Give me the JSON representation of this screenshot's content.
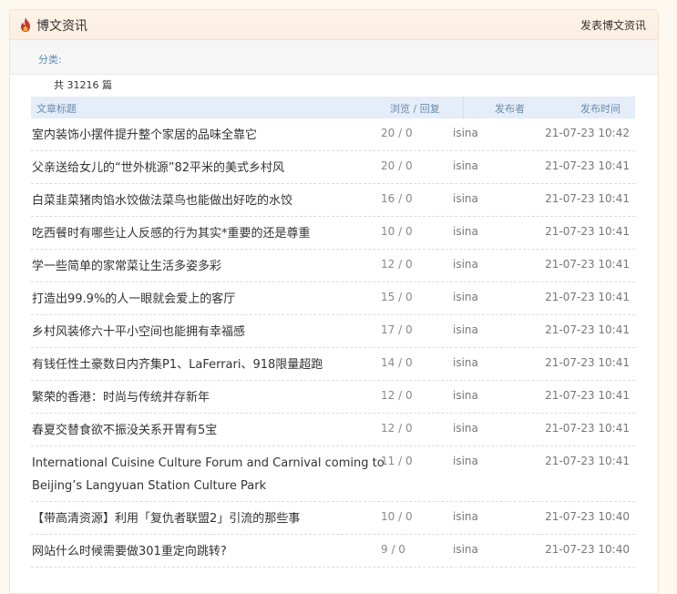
{
  "header": {
    "title": "博文资讯",
    "post_link": "发表博文资讯",
    "icon": "flame-icon",
    "accent_color": "#c0392b"
  },
  "filter": {
    "label": "分类:"
  },
  "summary": {
    "total": "共 31216 篇"
  },
  "columns": {
    "title": "文章标题",
    "views": "浏览 / 回复",
    "author": "发布者",
    "time": "发布时间"
  },
  "articles": [
    {
      "title": "室内装饰小摆件提升整个家居的品味全靠它",
      "views": "20 / 0",
      "author": "isina",
      "time": "21-07-23 10:42"
    },
    {
      "title": "父亲送给女儿的“世外桃源”82平米的美式乡村风",
      "views": "20 / 0",
      "author": "isina",
      "time": "21-07-23 10:41"
    },
    {
      "title": "白菜韭菜猪肉馅水饺做法菜鸟也能做出好吃的水饺",
      "views": "16 / 0",
      "author": "isina",
      "time": "21-07-23 10:41"
    },
    {
      "title": "吃西餐时有哪些让人反感的行为其实*重要的还是尊重",
      "views": "10 / 0",
      "author": "isina",
      "time": "21-07-23 10:41"
    },
    {
      "title": "学一些简单的家常菜让生活多姿多彩",
      "views": "12 / 0",
      "author": "isina",
      "time": "21-07-23 10:41"
    },
    {
      "title": "打造出99.9%的人一眼就会爱上的客厅",
      "views": "15 / 0",
      "author": "isina",
      "time": "21-07-23 10:41"
    },
    {
      "title": "乡村风装修六十平小空间也能拥有幸福感",
      "views": "17 / 0",
      "author": "isina",
      "time": "21-07-23 10:41"
    },
    {
      "title": "有钱任性土豪数日内齐集P1、LaFerrari、918限量超跑",
      "views": "14 / 0",
      "author": "isina",
      "time": "21-07-23 10:41"
    },
    {
      "title": "繁荣的香港：时尚与传统并存新年",
      "views": "12 / 0",
      "author": "isina",
      "time": "21-07-23 10:41"
    },
    {
      "title": "春夏交替食欲不振没关系开胃有5宝",
      "views": "12 / 0",
      "author": "isina",
      "time": "21-07-23 10:41"
    },
    {
      "title": "International Cuisine Culture Forum and Carnival coming to Beijing’s Langyuan Station Culture Park",
      "views": "11 / 0",
      "author": "isina",
      "time": "21-07-23 10:41"
    },
    {
      "title": "【带高清资源】利用「复仇者联盟2」引流的那些事",
      "views": "10 / 0",
      "author": "isina",
      "time": "21-07-23 10:40"
    },
    {
      "title": "网站什么时候需要做301重定向跳转?",
      "views": "9 / 0",
      "author": "isina",
      "time": "21-07-23 10:40"
    }
  ]
}
